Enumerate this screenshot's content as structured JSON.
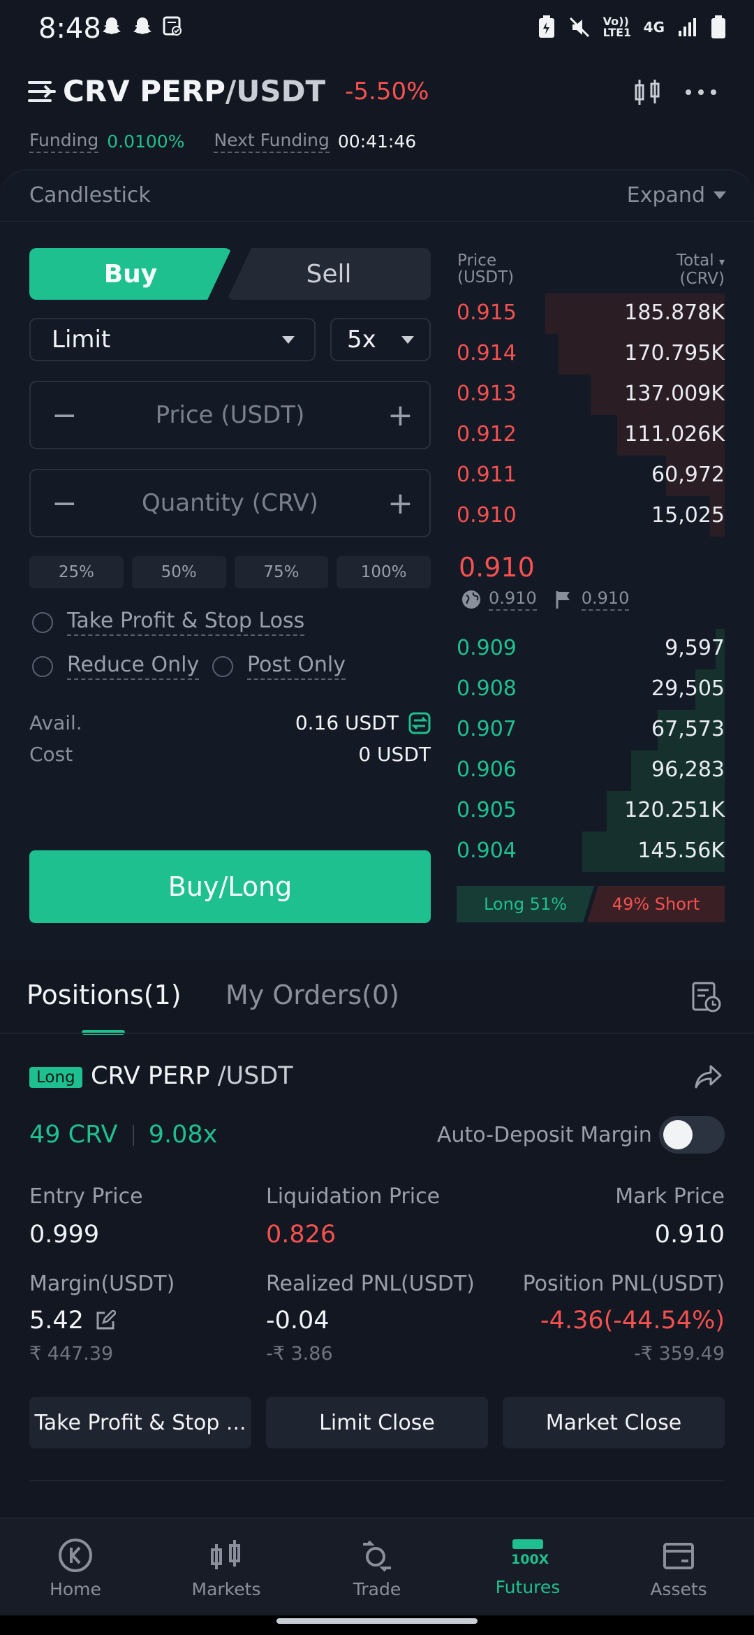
{
  "status_bar": {
    "time": "8:48",
    "icons": [
      "snapchat-icon",
      "snapchat-icon",
      "calendar-check-icon",
      "battery-saver-icon",
      "mute-icon",
      "volte-icon",
      "4g-icon",
      "signal-icon",
      "battery-icon"
    ],
    "volte_text": "Vo)) LTE1",
    "net_text": "4G"
  },
  "header": {
    "pair_base": "CRV PERP",
    "pair_quote": "/USDT",
    "change_pct": "-5.50%",
    "funding_label": "Funding",
    "funding_value": "0.0100%",
    "next_funding_label": "Next Funding",
    "next_funding_value": "00:41:46"
  },
  "chart_bar": {
    "label": "Candlestick",
    "expand_label": "Expand"
  },
  "order_form": {
    "buy_label": "Buy",
    "sell_label": "Sell",
    "order_type": "Limit",
    "leverage": "5x",
    "price_placeholder": "Price (USDT)",
    "quantity_placeholder": "Quantity (CRV)",
    "pct_buttons": [
      "25%",
      "50%",
      "75%",
      "100%"
    ],
    "tp_sl_label": "Take Profit & Stop Loss",
    "reduce_only_label": "Reduce Only",
    "post_only_label": "Post Only",
    "avail_label": "Avail.",
    "avail_value": "0.16 USDT",
    "cost_label": "Cost",
    "cost_value": "0 USDT",
    "submit_label": "Buy/Long"
  },
  "order_book": {
    "price_header": "Price",
    "price_unit": "(USDT)",
    "total_header": "Total",
    "total_unit": "(CRV)",
    "asks": [
      {
        "price": "0.915",
        "total": "185.878K",
        "depth": 0.67
      },
      {
        "price": "0.914",
        "total": "170.795K",
        "depth": 0.62
      },
      {
        "price": "0.913",
        "total": "137.009K",
        "depth": 0.5
      },
      {
        "price": "0.912",
        "total": "111.026K",
        "depth": 0.4
      },
      {
        "price": "0.911",
        "total": "60,972",
        "depth": 0.22
      },
      {
        "price": "0.910",
        "total": "15,025",
        "depth": 0.055
      }
    ],
    "last_price": "0.910",
    "index_price": "0.910",
    "mark_price": "0.910",
    "bids": [
      {
        "price": "0.909",
        "total": "9,597",
        "depth": 0.035
      },
      {
        "price": "0.908",
        "total": "29,505",
        "depth": 0.11
      },
      {
        "price": "0.907",
        "total": "67,573",
        "depth": 0.25
      },
      {
        "price": "0.906",
        "total": "96,283",
        "depth": 0.35
      },
      {
        "price": "0.905",
        "total": "120.251K",
        "depth": 0.44
      },
      {
        "price": "0.904",
        "total": "145.56K",
        "depth": 0.53
      }
    ],
    "long_label": "Long 51%",
    "short_label": "49% Short"
  },
  "positions": {
    "tab_positions": "Positions(1)",
    "tab_orders": "My Orders(0)",
    "badge": "Long",
    "pair_base": "CRV PERP",
    "pair_quote": " /USDT",
    "size": "49 CRV",
    "leverage": "9.08x",
    "auto_deposit_label": "Auto-Deposit Margin",
    "entry_price_label": "Entry Price",
    "entry_price": "0.999",
    "liq_price_label": "Liquidation Price",
    "liq_price": "0.826",
    "mark_price_label": "Mark Price",
    "mark_price": "0.910",
    "margin_label": "Margin(USDT)",
    "margin": "5.42",
    "margin_inr": "₹ 447.39",
    "realized_label": "Realized PNL(USDT)",
    "realized": "-0.04",
    "realized_inr": "-₹ 3.86",
    "pos_pnl_label": "Position PNL(USDT)",
    "pos_pnl": "-4.36(-44.54%)",
    "pos_pnl_inr": "-₹ 359.49",
    "btn_tpsl": "Take Profit & Stop ...",
    "btn_limit_close": "Limit Close",
    "btn_market_close": "Market Close"
  },
  "nav": {
    "home": "Home",
    "markets": "Markets",
    "trade": "Trade",
    "futures": "Futures",
    "futures_icon_text": "100X",
    "assets": "Assets"
  },
  "colors": {
    "bg": "#121722",
    "green": "#1fc08f",
    "red": "#f5514f",
    "panel": "#131925"
  }
}
